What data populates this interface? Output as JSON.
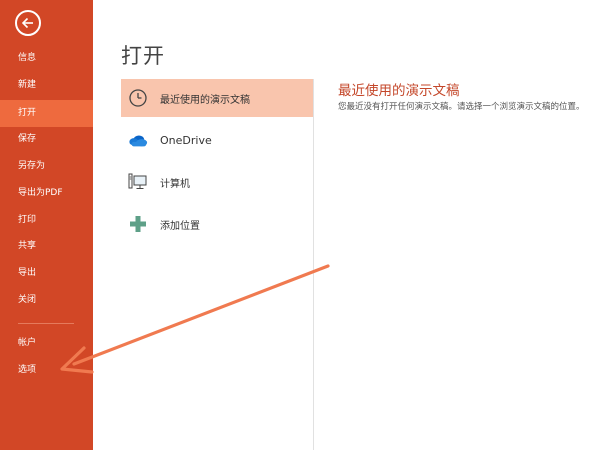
{
  "sidebar": {
    "back_icon": "back-arrow-icon",
    "items": [
      {
        "label": "信息"
      },
      {
        "label": "新建"
      },
      {
        "label": "打开",
        "active": true
      },
      {
        "label": "保存"
      },
      {
        "label": "另存为"
      },
      {
        "label": "导出为PDF"
      },
      {
        "label": "打印"
      },
      {
        "label": "共享"
      },
      {
        "label": "导出"
      },
      {
        "label": "关闭"
      },
      {
        "label": "帐户"
      },
      {
        "label": "选项"
      }
    ]
  },
  "main": {
    "title": "打开",
    "locations": [
      {
        "label": "最近使用的演示文稿",
        "icon": "clock-icon",
        "selected": true
      },
      {
        "label": "OneDrive",
        "icon": "cloud-icon"
      },
      {
        "label": "计算机",
        "icon": "computer-icon"
      },
      {
        "label": "添加位置",
        "icon": "plus-icon"
      }
    ],
    "recent": {
      "title": "最近使用的演示文稿",
      "description": "您最近没有打开任何演示文稿。请选择一个浏览演示文稿的位置。"
    }
  },
  "colors": {
    "sidebar_bg": "#d24726",
    "sidebar_active": "#ee6a3e",
    "selected_bg": "#f9c5ad",
    "accent_text": "#c4472a",
    "arrow": "#f07a50"
  }
}
